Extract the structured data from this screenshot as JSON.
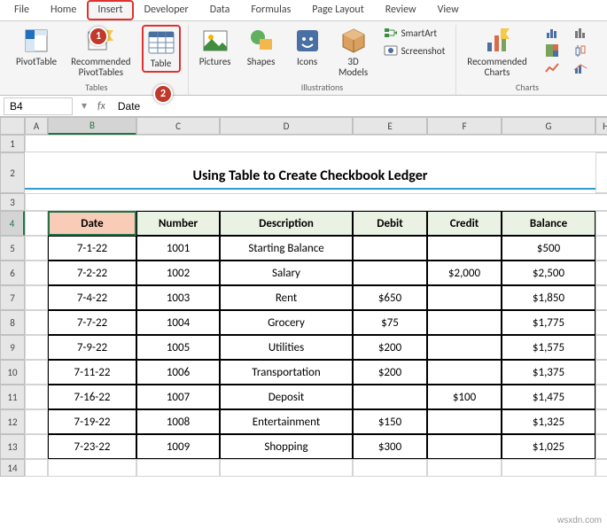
{
  "menu": {
    "file": "File"
  },
  "tabs": [
    "Home",
    "Insert",
    "Developer",
    "Data",
    "Formulas",
    "Page Layout",
    "Review",
    "View"
  ],
  "ribbon": {
    "tables": {
      "label": "Tables",
      "pivot": "PivotTable",
      "recommended": "Recommended\nPivotTables",
      "table": "Table"
    },
    "illustrations": {
      "label": "Illustrations",
      "pictures": "Pictures",
      "shapes": "Shapes",
      "icons": "Icons",
      "models": "3D\nModels",
      "smartart": "SmartArt",
      "screenshot": "Screenshot"
    },
    "charts": {
      "label": "Charts",
      "recommended": "Recommended\nCharts"
    }
  },
  "callouts": {
    "c1": "1",
    "c2": "2"
  },
  "namebox": "B4",
  "fx": "fx",
  "formula_value": "Date",
  "cols": [
    "A",
    "B",
    "C",
    "D",
    "E",
    "F",
    "G",
    "H"
  ],
  "rows": [
    "1",
    "2",
    "3",
    "4",
    "5",
    "6",
    "7",
    "8",
    "9",
    "10",
    "11",
    "12",
    "13",
    "14"
  ],
  "title": "Using Table to Create Checkbook Ledger",
  "headers": {
    "date": "Date",
    "number": "Number",
    "desc": "Description",
    "debit": "Debit",
    "credit": "Credit",
    "balance": "Balance"
  },
  "data": [
    {
      "date": "7-1-22",
      "num": "1001",
      "desc": "Starting Balance",
      "debit": "",
      "credit": "",
      "bal": "$500"
    },
    {
      "date": "7-2-22",
      "num": "1002",
      "desc": "Salary",
      "debit": "",
      "credit": "$2,000",
      "bal": "$2,500"
    },
    {
      "date": "7-4-22",
      "num": "1003",
      "desc": "Rent",
      "debit": "$650",
      "credit": "",
      "bal": "$1,850"
    },
    {
      "date": "7-7-22",
      "num": "1004",
      "desc": "Grocery",
      "debit": "$75",
      "credit": "",
      "bal": "$1,775"
    },
    {
      "date": "7-9-22",
      "num": "1005",
      "desc": "Utilities",
      "debit": "$200",
      "credit": "",
      "bal": "$1,575"
    },
    {
      "date": "7-11-22",
      "num": "1006",
      "desc": "Transportation",
      "debit": "$200",
      "credit": "",
      "bal": "$1,375"
    },
    {
      "date": "7-16-22",
      "num": "1007",
      "desc": "Deposit",
      "debit": "",
      "credit": "$100",
      "bal": "$1,475"
    },
    {
      "date": "7-19-22",
      "num": "1008",
      "desc": "Entertainment",
      "debit": "$150",
      "credit": "",
      "bal": "$1,325"
    },
    {
      "date": "7-23-22",
      "num": "1009",
      "desc": "Shopping",
      "debit": "$300",
      "credit": "",
      "bal": "$1,025"
    }
  ],
  "watermark": "wsxdn.com"
}
